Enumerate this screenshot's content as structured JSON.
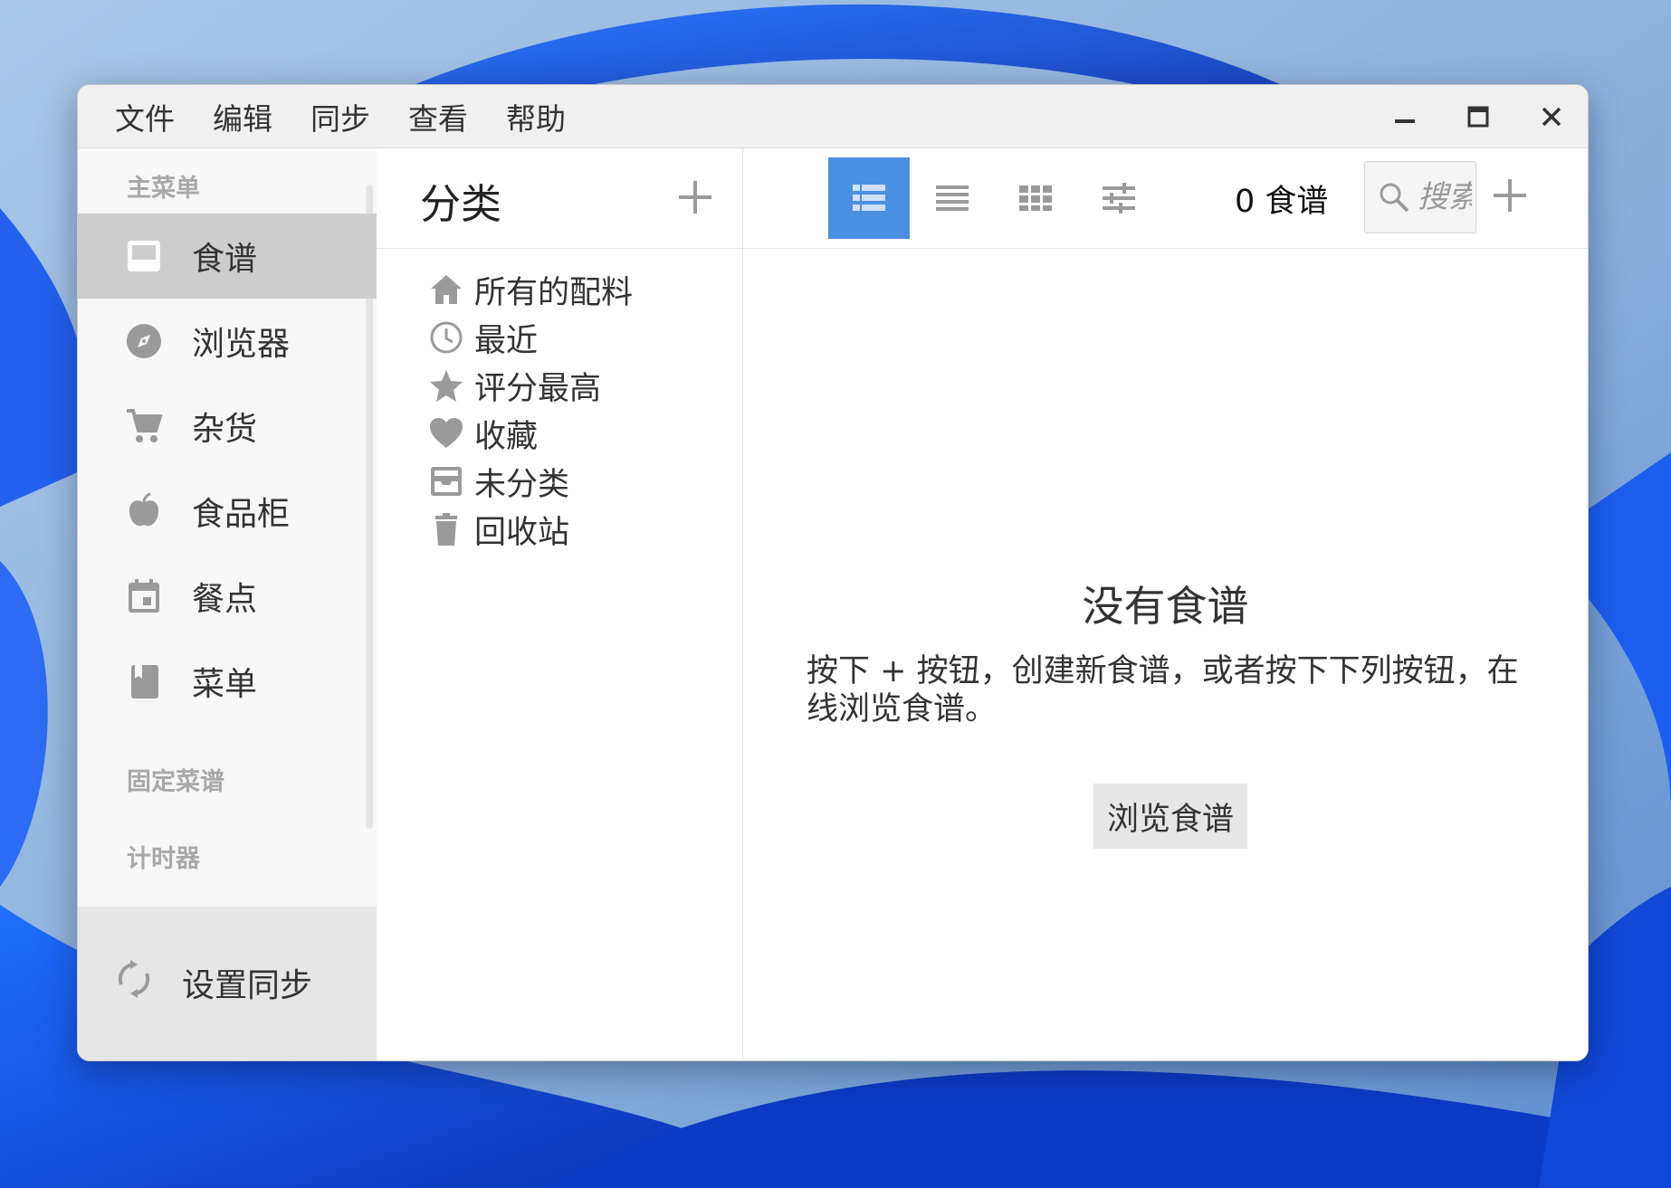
{
  "menubar": {
    "items": [
      "文件",
      "编辑",
      "同步",
      "查看",
      "帮助"
    ]
  },
  "sidebar": {
    "section_main": "主菜单",
    "items": [
      {
        "label": "食谱",
        "icon": "inbox-icon",
        "active": true
      },
      {
        "label": "浏览器",
        "icon": "compass-icon",
        "active": false
      },
      {
        "label": "杂货",
        "icon": "cart-icon",
        "active": false
      },
      {
        "label": "食品柜",
        "icon": "apple-icon",
        "active": false
      },
      {
        "label": "餐点",
        "icon": "calendar-icon",
        "active": false
      },
      {
        "label": "菜单",
        "icon": "book-icon",
        "active": false
      }
    ],
    "section_pinned": "固定菜谱",
    "section_timers": "计时器",
    "sync_label": "设置同步"
  },
  "categories": {
    "title": "分类",
    "items": [
      {
        "label": "所有的配料",
        "icon": "home-icon"
      },
      {
        "label": "最近",
        "icon": "clock-icon"
      },
      {
        "label": "评分最高",
        "icon": "star-icon"
      },
      {
        "label": "收藏",
        "icon": "heart-icon"
      },
      {
        "label": "未分类",
        "icon": "tray-icon"
      },
      {
        "label": "回收站",
        "icon": "trash-icon"
      }
    ]
  },
  "toolbar": {
    "recipe_count": "0 食谱",
    "search_placeholder": "搜索"
  },
  "empty_state": {
    "title": "没有食谱",
    "text": "按下 + 按钮，创建新食谱，或者按下下列按钮，在线浏览食谱。",
    "button": "浏览食谱"
  },
  "colors": {
    "accent": "#4a8fe0",
    "sidebar_active": "#cdcdcd",
    "icon_gray": "#9a9a9a"
  }
}
